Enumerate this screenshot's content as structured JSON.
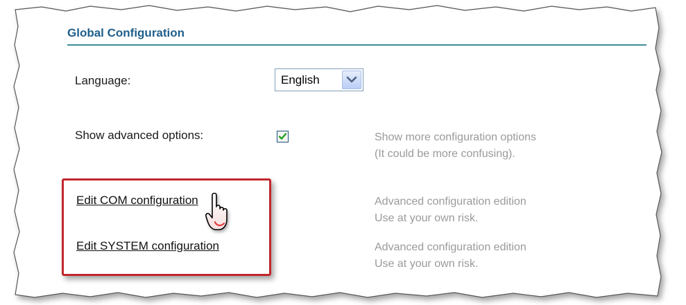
{
  "section": {
    "title": "Global Configuration"
  },
  "language": {
    "label": "Language:",
    "selected": "English"
  },
  "advanced": {
    "label": "Show advanced options:",
    "checked": true,
    "desc_line1": "Show more configuration options",
    "desc_line2": "(It could be more confusing)."
  },
  "com_config": {
    "link": "Edit COM configuration",
    "desc_line1": "Advanced configuration edition",
    "desc_line2": "Use at your own risk."
  },
  "system_config": {
    "link": "Edit SYSTEM configuration",
    "desc_line1": "Advanced configuration edition",
    "desc_line2": "Use at your own risk."
  },
  "colors": {
    "title": "#1f5f8b",
    "rule": "#3c8c9a",
    "highlight": "#c1272d",
    "description": "#9a9a9a"
  },
  "icons": {
    "dropdown": "chevron-down-icon",
    "check": "check-icon",
    "cursor": "hand-pointer-icon"
  }
}
